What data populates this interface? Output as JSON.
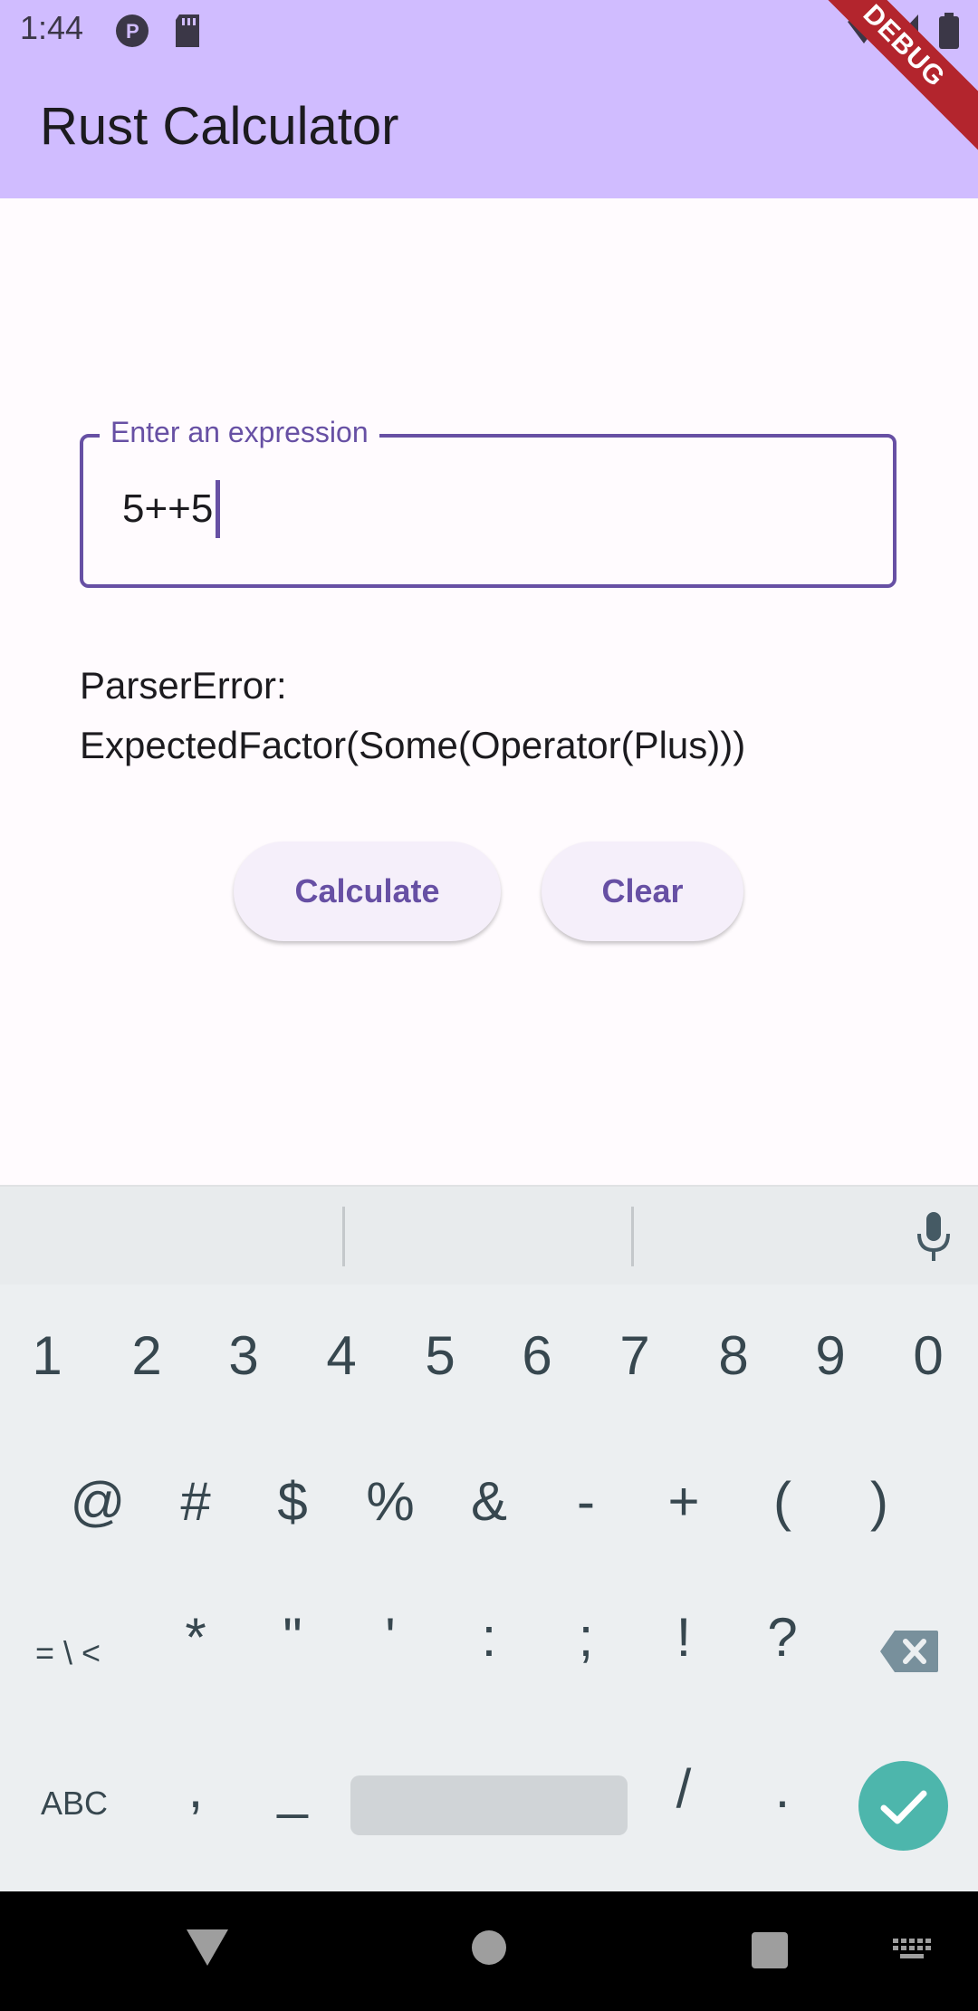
{
  "status_bar": {
    "time": "1:44"
  },
  "app_bar": {
    "title": "Rust Calculator",
    "debug_banner": "DEBUG"
  },
  "input": {
    "label": "Enter an expression",
    "value": "5++5"
  },
  "result": {
    "line1": "ParserError:",
    "line2": "ExpectedFactor(Some(Operator(Plus)))"
  },
  "buttons": {
    "calculate": "Calculate",
    "clear": "Clear"
  },
  "keyboard": {
    "row1": [
      "1",
      "2",
      "3",
      "4",
      "5",
      "6",
      "7",
      "8",
      "9",
      "0"
    ],
    "row2": [
      "@",
      "#",
      "$",
      "%",
      "&",
      "-",
      "+",
      "(",
      ")"
    ],
    "row3": [
      "= \\ <",
      "*",
      "\"",
      "'",
      ":",
      ";",
      "!",
      "?"
    ],
    "row4": [
      "ABC",
      ",",
      "_",
      "/",
      "."
    ]
  },
  "colors": {
    "app_bar": "#d0bcff",
    "accent": "#6750a4",
    "enter_key": "#4db6ac",
    "debug": "#b3252d"
  }
}
